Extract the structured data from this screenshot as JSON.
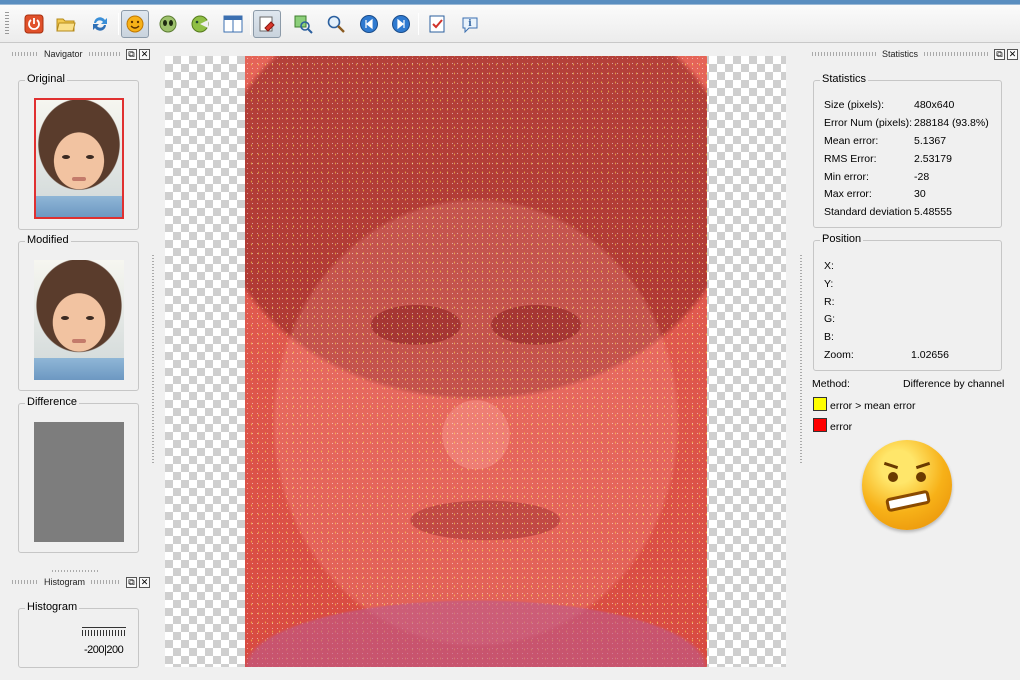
{
  "toolbar": {
    "icons": [
      "power-icon",
      "open-folder-icon",
      "refresh-icon",
      "smiley-icon",
      "alien-icon",
      "pacman-icon",
      "window-split-icon",
      "eraser-icon",
      "search-image-icon",
      "zoom-icon",
      "first-icon",
      "next-icon",
      "checklist-icon",
      "info-icon"
    ],
    "active_indices": [
      3,
      7
    ]
  },
  "navigator": {
    "title": "Navigator",
    "original_label": "Original",
    "modified_label": "Modified",
    "difference_label": "Difference"
  },
  "histogram": {
    "title": "Histogram",
    "group_label": "Histogram",
    "axis_text": "-200|200"
  },
  "statistics_dock": {
    "title": "Statistics",
    "group_label": "Statistics",
    "rows": [
      {
        "label": "Size (pixels):",
        "value": "480x640"
      },
      {
        "label": "Error Num (pixels):",
        "value": "288184 (93.8%)"
      },
      {
        "label": "Mean error:",
        "value": "5.1367"
      },
      {
        "label": "RMS Error:",
        "value": "2.53179"
      },
      {
        "label": "Min error:",
        "value": "-28"
      },
      {
        "label": "Max error:",
        "value": "30"
      },
      {
        "label": "Standard deviation",
        "value": "5.48555"
      }
    ]
  },
  "position": {
    "group_label": "Position",
    "rows": [
      {
        "label": "X:",
        "value": ""
      },
      {
        "label": "Y:",
        "value": ""
      },
      {
        "label": "R:",
        "value": ""
      },
      {
        "label": "G:",
        "value": ""
      },
      {
        "label": "B:",
        "value": ""
      },
      {
        "label": "Zoom:",
        "value": "1.02656"
      }
    ]
  },
  "method": {
    "label": "Method:",
    "value": "Difference by channel",
    "legend": [
      {
        "color": "#ffff00",
        "text": "error > mean error"
      },
      {
        "color": "#ff0000",
        "text": "error"
      }
    ]
  },
  "colors": {
    "diff_overlay": "#df5247",
    "selected_border": "#e03030",
    "difference_thumb": "#7d7d7d"
  }
}
